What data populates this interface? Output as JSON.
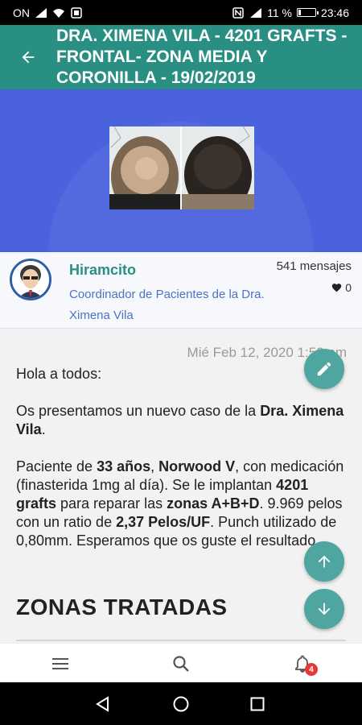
{
  "status": {
    "carrier": "ON",
    "battery": "11 %",
    "time": "23:46"
  },
  "header": {
    "title": "DRA. XIMENA VILA - 4201 GRAFTS - FRONTAL- ZONA MEDIA Y CORONILLA - 19/02/2019"
  },
  "author": {
    "name": "Hiramcito",
    "role": "Coordinador de Pacientes de la Dra. Ximena Vila",
    "messages": "541 mensajes",
    "likes": "0"
  },
  "post": {
    "date": "Mié Feb 12, 2020 1:50 pm",
    "p1": "Hola a todos:",
    "p2_a": "Os presentamos un nuevo caso de la ",
    "p2_b": "Dra. Ximena Vila",
    "p2_c": ".",
    "p3_a": "Paciente de ",
    "p3_b": "33 años",
    "p3_c": ", ",
    "p3_d": "Norwood V",
    "p3_e": ", con medicación (finasterida 1mg al día). Se le implantan ",
    "p3_f": "4201 grafts",
    "p3_g": " para reparar las ",
    "p3_h": "zonas A+B+D",
    "p3_i": ". 9.969 pelos con un ratio de ",
    "p3_j": "2,37 Pelos/UF",
    "p3_k": ". Punch utilizado de 0,80mm. Esperamos que os guste el resultado.",
    "heading": "ZONAS TRATADAS"
  },
  "bottom_nav": {
    "notifications_badge": "4"
  },
  "icons": {
    "back": "arrow-left-icon",
    "edit": "pencil-icon",
    "scroll_up": "arrow-up-icon",
    "scroll_down": "arrow-down-icon",
    "menu": "hamburger-icon",
    "search": "search-icon",
    "notifications": "bell-icon"
  },
  "colors": {
    "app_bar": "#2a8f83",
    "hero": "#4a62de",
    "fab": "#4fa5a0",
    "author_name": "#2a8f83",
    "author_role": "#4a74c4",
    "badge": "#e53935"
  }
}
